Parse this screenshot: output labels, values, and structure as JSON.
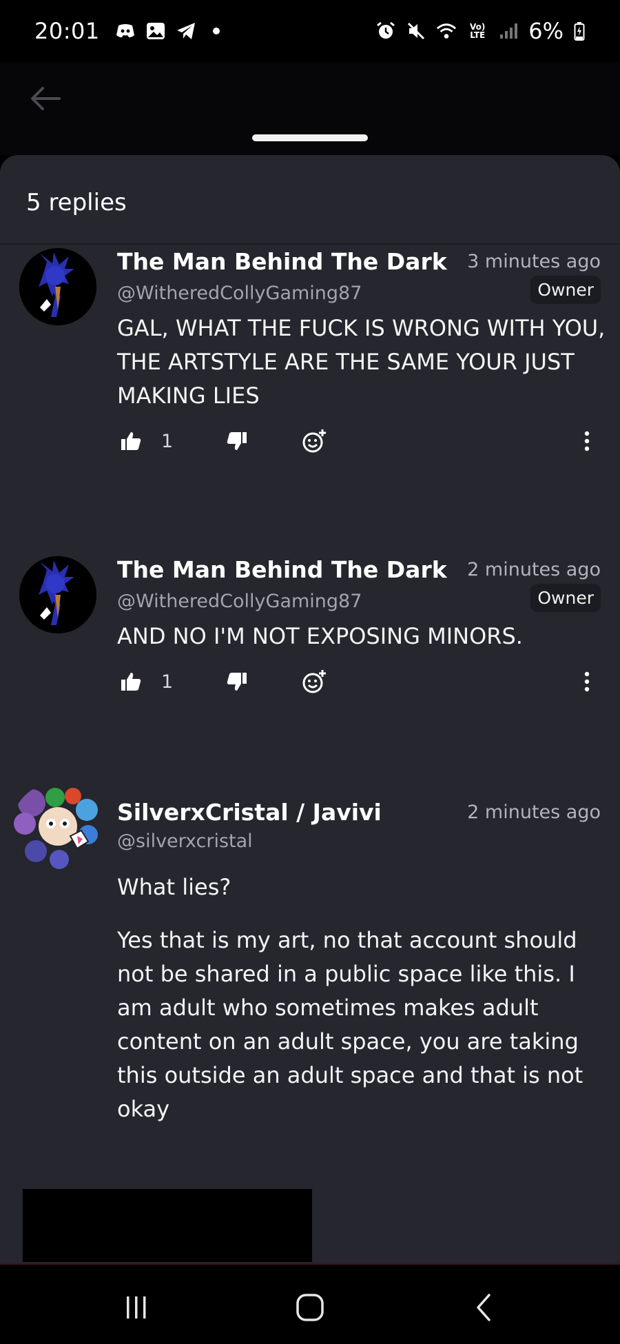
{
  "status_bar": {
    "time": "20:01",
    "battery_percent": "6%",
    "left_icons": [
      "discord-icon",
      "gallery-icon",
      "telegram-icon",
      "dot-icon"
    ],
    "right_icons": [
      "alarm-icon",
      "mute-icon",
      "wifi-icon",
      "volte-icon",
      "signal-icon",
      "battery-charging-icon"
    ],
    "volte_label": "Vo) LTE"
  },
  "sheet": {
    "replies_label": "5 replies"
  },
  "comments": [
    {
      "author": "The Man Behind The Dark",
      "handle": "@WitheredCollyGaming87",
      "time": "3 minutes ago",
      "badge": "Owner",
      "paragraphs": [
        "GAL, WHAT THE FUCK IS WRONG WITH YOU, THE ARTSTYLE ARE THE SAME YOUR JUST MAKING LIES"
      ],
      "likes": "1"
    },
    {
      "author": "The Man Behind The Dark",
      "handle": "@WitheredCollyGaming87",
      "time": "2 minutes ago",
      "badge": "Owner",
      "paragraphs": [
        "AND NO I'M NOT EXPOSING MINORS."
      ],
      "likes": "1"
    },
    {
      "author": "SilverxCristal / Javivi",
      "handle": "@silverxcristal",
      "time": "2 minutes ago",
      "paragraphs": [
        "What lies?",
        "Yes that is my art, no that account should not be shared in a public space like this.  I am adult who sometimes makes adult content on an adult space, you are taking this outside an adult space and that is not okay"
      ]
    }
  ],
  "colors": {
    "sheet_bg": "#25262e",
    "topbar_bg": "#060608",
    "badge_bg": "#1b1c21",
    "secondary_text": "#a4a5ab"
  }
}
